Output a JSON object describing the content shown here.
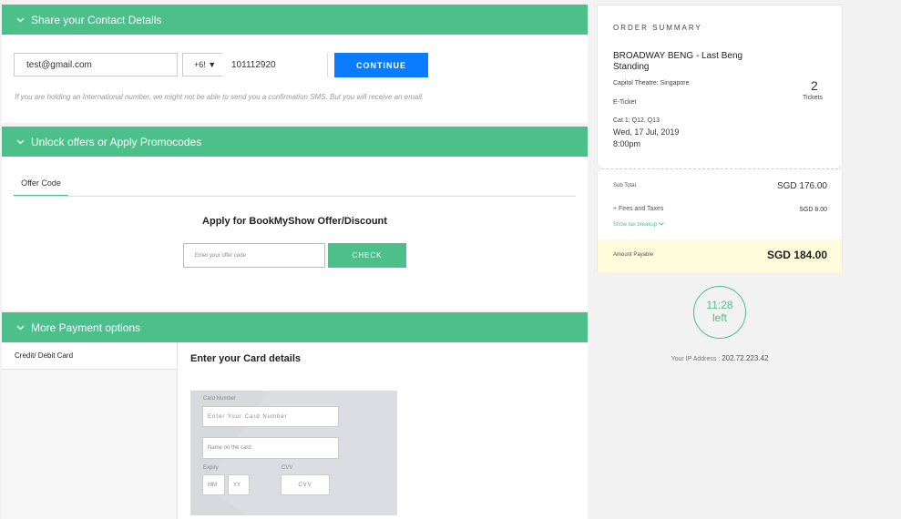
{
  "contact": {
    "header": "Share your Contact Details",
    "email": "test@gmail.com",
    "country_code": "+6! ▼",
    "phone": "101112920",
    "continue_label": "CONTINUE",
    "note": "If you are holding an International number, we might not be able to send you a confirmation SMS. But you will receive an email."
  },
  "offers": {
    "header": "Unlock offers or Apply Promocodes",
    "tab": "Offer Code",
    "title": "Apply for BookMyShow Offer/Discount",
    "placeholder": "Enter your offer code",
    "check_label": "CHECK"
  },
  "payment": {
    "header": "More Payment options",
    "method": "Credit/ Debit Card",
    "card_title": "Enter your Card details",
    "card_number_label": "Card Number",
    "card_number_placeholder": "Enter Your Card Number",
    "name_placeholder": "Name on the card",
    "expiry_label": "Expiry",
    "cvv_label": "CVV",
    "mm": "MM",
    "yy": "YY",
    "cvv_placeholder": "CVV"
  },
  "summary": {
    "heading": "ORDER SUMMARY",
    "event": "BROADWAY BENG - Last Beng Standing",
    "venue": "Capitol Theatre: Singapore",
    "ticket_type": "E-Ticket",
    "seats": "Cat 1: Q12, Q13",
    "date": "Wed, 17 Jul, 2019",
    "time": "8:00pm",
    "ticket_count": "2",
    "ticket_label": "Tickets",
    "subtotal_label": "Sub Total",
    "subtotal": "SGD 176.00",
    "fees_label": "+ Fees and Taxes",
    "fees": "SGD 8.00",
    "breakup": "Show tax breakup",
    "payable_label": "Amount Payable",
    "payable": "SGD 184.00"
  },
  "timer": {
    "time": "11:28",
    "label": "left"
  },
  "ip": {
    "label": "Your IP Address :",
    "value": "202.72.223.42"
  },
  "colors": {
    "green": "#4dbf8b",
    "blue": "#0a7cff",
    "payable_bg": "#fffcdb"
  }
}
